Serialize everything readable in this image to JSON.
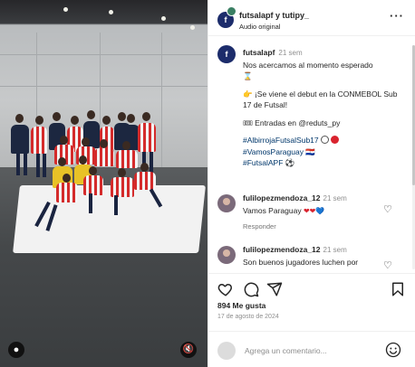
{
  "header": {
    "authors": "futsalapf y tutipy_",
    "audio": "Audio original",
    "more_icon": "more-horizontal-icon"
  },
  "caption": {
    "username": "futsalapf",
    "time": "21 sem",
    "line1": "Nos acercamos al momento esperado",
    "line2": "¡Se viene el debut en la CONMEBOL Sub 17 de Futsal!",
    "line3": "Entradas en @reduts_py",
    "hashtag1": "#AlbirrojaFutsalSub17",
    "hashtag2": "#VamosParaguay",
    "suffix2": "🇵🇾",
    "hashtag3": "#FutsalAPF",
    "suffix3": "⚽"
  },
  "comments": [
    {
      "username": "fulilopezmendoza_12",
      "time": "21 sem",
      "text": "Vamos Paraguay",
      "emojis": "❤❤💙",
      "reply": "Responder"
    },
    {
      "username": "fulilopezmendoza_12",
      "time": "21 sem",
      "text": "Son buenos jugadores luchen por"
    }
  ],
  "post": {
    "likes": "894 Me gusta",
    "date": "17 de agosto de 2024"
  },
  "add_comment": {
    "placeholder": "Agrega un comentario..."
  },
  "colors": {
    "text": "#262626",
    "muted": "#8e8e8e",
    "hashtag": "#00376b",
    "brand_avatar": "#1c2c6b"
  }
}
